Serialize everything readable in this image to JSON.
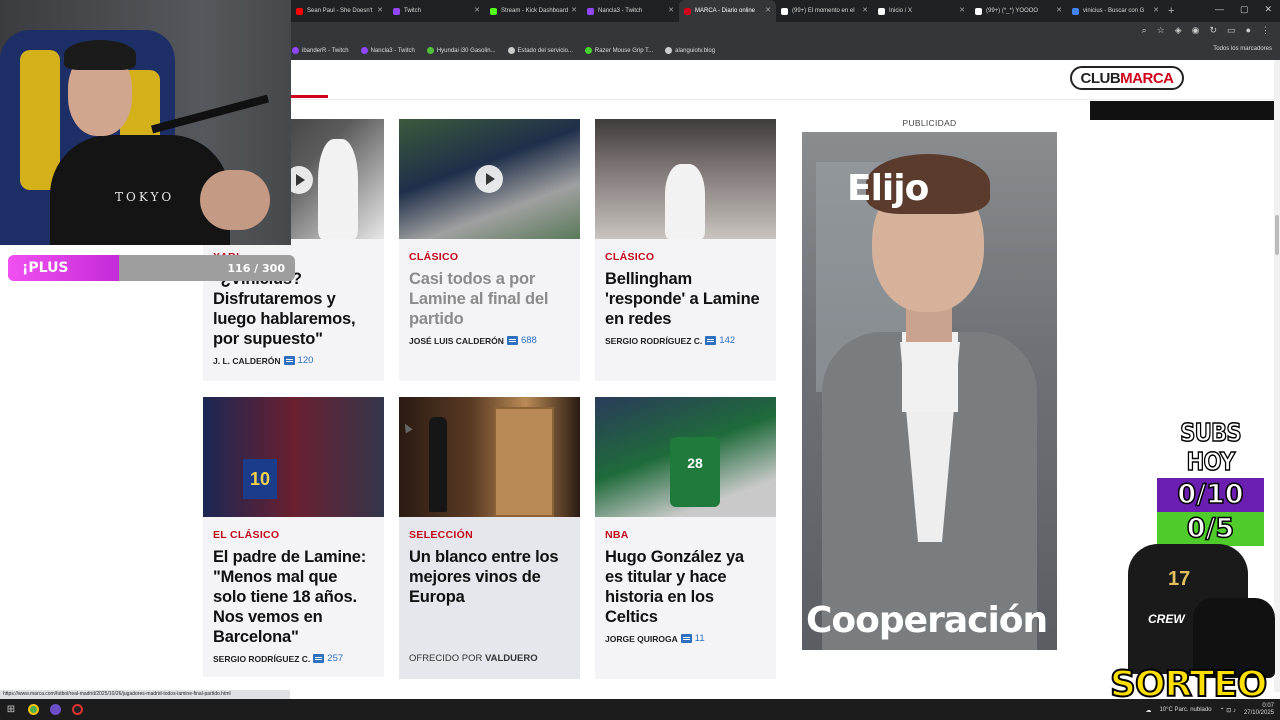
{
  "browser": {
    "tabs": [
      {
        "label": "Sean Paul - She Doesn't",
        "color": "#ff0000",
        "active": false
      },
      {
        "label": "Twitch",
        "color": "#9146ff",
        "active": false
      },
      {
        "label": "Stream - Kick Dashboard",
        "color": "#53fc18",
        "active": false
      },
      {
        "label": "Nancla3 - Twitch",
        "color": "#9146ff",
        "active": false
      },
      {
        "label": "MARCA - Diario online",
        "color": "#d0021b",
        "active": true
      },
      {
        "label": "(99+) El momento en el",
        "color": "#ffffff",
        "active": false
      },
      {
        "label": "Inicio / X",
        "color": "#ffffff",
        "active": false
      },
      {
        "label": "(99+) (*_*) YOOOO",
        "color": "#ffffff",
        "active": false
      },
      {
        "label": "vinicius - Buscar con G",
        "color": "#4285f4",
        "active": false
      }
    ],
    "bookmarks": [
      {
        "label": "ibanderR - Twitch",
        "color": "#9146ff"
      },
      {
        "label": "Nancla3 - Twitch",
        "color": "#9146ff"
      },
      {
        "label": "Hyundai i30 Gasolin...",
        "color": "#53c23b"
      },
      {
        "label": "Estado del servicio...",
        "color": "#cccccc"
      },
      {
        "label": "Razer Mouse Grip T...",
        "color": "#44d62c"
      },
      {
        "label": "alanguiotv.blog",
        "color": "#cccccc"
      }
    ],
    "bookmarks_all": "Todos los marcadores",
    "status_url": "https://www.marca.com/futbol/real-madrid/2025/10/26/jugadores-madrid-todos-lamine-final-partido.html"
  },
  "site": {
    "brand_club": "CLUB",
    "brand_marca": "MARCA",
    "ad_label": "PUBLICIDAD",
    "ad_top_text": "Elijo",
    "ad_bottom_text": "Cooperación"
  },
  "articles": [
    {
      "kicker": "XABI",
      "headline": "\"¿Vinicius? Disfrutaremos y luego hablaremos, por supuesto\"",
      "author": "J. L. CALDERÓN",
      "comments": "120",
      "muted": false
    },
    {
      "kicker": "CLÁSICO",
      "headline": "Casi todos a por Lamine al final del partido",
      "author": "JOSÉ LUIS CALDERÓN",
      "comments": "688",
      "muted": true
    },
    {
      "kicker": "CLÁSICO",
      "headline": "Bellingham 'responde' a Lamine en redes",
      "author": "SERGIO RODRÍGUEZ C.",
      "comments": "142",
      "muted": false
    },
    {
      "kicker": "EL CLÁSICO",
      "headline": "El padre de Lamine: \"Menos mal que solo tiene 18 años. Nos vemos en Barcelona\"",
      "author": "SERGIO RODRÍGUEZ C.",
      "comments": "257",
      "muted": false
    },
    {
      "kicker": "SELECCIÓN",
      "headline": "Un blanco entre los mejores vinos de Europa",
      "sponsor_prefix": "OFRECIDO POR",
      "sponsor": "VALDUERO",
      "muted": false
    },
    {
      "kicker": "NBA",
      "headline": "Hugo González ya es titular y hace historia en los Celtics",
      "author": "JORGE QUIROGA",
      "comments": "11",
      "muted": false
    }
  ],
  "overlays": {
    "progress_label": "¡PLUS",
    "progress_count": "116 / 300",
    "progress_value": 116,
    "progress_max": 300,
    "subs_title": "SUBS HOY",
    "subs_row1": "0/10",
    "subs_row2": "0/5",
    "merch_crew": "CREW",
    "merch_number": "17",
    "sorteo": "SORTEO",
    "webcam_shirt": "TOKYO"
  },
  "taskbar": {
    "weather": "10°C  Parc. nublado",
    "time": "0:07",
    "date": "27/10/2025"
  },
  "colors": {
    "accent_red": "#c0061b",
    "comment_blue": "#2f6fbf",
    "progress_pink": "#e040e8",
    "subs_purple": "#6a1fb0",
    "subs_green": "#4fcc2b"
  }
}
